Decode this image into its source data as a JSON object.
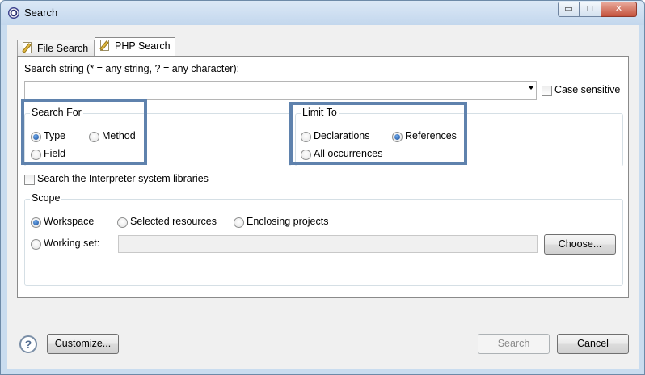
{
  "window": {
    "title": "Search",
    "controls": {
      "minimize": "▭",
      "maximize": "□",
      "close": "✕"
    }
  },
  "tabs": [
    {
      "label": "File Search",
      "icon": "file-search-icon",
      "active": false
    },
    {
      "label": "PHP Search",
      "icon": "php-search-icon",
      "active": true
    }
  ],
  "search_string": {
    "label": "Search string (* = any string, ? = any character):",
    "value": "",
    "case_sensitive_label": "Case sensitive",
    "case_sensitive": false
  },
  "search_for": {
    "title": "Search For",
    "options": [
      {
        "label": "Type",
        "selected": true
      },
      {
        "label": "Method",
        "selected": false
      },
      {
        "label": "Field",
        "selected": false
      }
    ]
  },
  "limit_to": {
    "title": "Limit To",
    "options": [
      {
        "label": "Declarations",
        "selected": false
      },
      {
        "label": "References",
        "selected": true
      },
      {
        "label": "All occurrences",
        "selected": false
      }
    ]
  },
  "interpreter_libs": {
    "label": "Search the Interpreter system libraries",
    "checked": false
  },
  "scope": {
    "title": "Scope",
    "options": [
      {
        "label": "Workspace",
        "selected": true
      },
      {
        "label": "Selected resources",
        "selected": false
      },
      {
        "label": "Enclosing projects",
        "selected": false
      },
      {
        "label": "Working set:",
        "selected": false
      }
    ],
    "working_set_value": "",
    "choose_label": "Choose..."
  },
  "footer": {
    "help_icon": "?",
    "customize_label": "Customize...",
    "search_label": "Search",
    "cancel_label": "Cancel"
  },
  "colors": {
    "highlight_border": "#5f82ad",
    "window_frame": "#c9dcef"
  }
}
